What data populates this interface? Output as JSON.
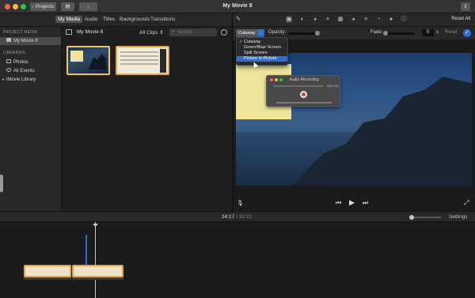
{
  "window": {
    "title": "My Movie 8"
  },
  "titlebar": {
    "projects_label": "Projects",
    "back_glyph": "‹"
  },
  "tabs": [
    {
      "label": "My Media",
      "active": true
    },
    {
      "label": "Audio",
      "active": false
    },
    {
      "label": "Titles",
      "active": false
    },
    {
      "label": "Backgrounds",
      "active": false
    },
    {
      "label": "Transitions",
      "active": false
    }
  ],
  "sidebar": {
    "project_header": "PROJECT MEDIA",
    "project_item": "My Movie 8",
    "libraries_header": "LIBRARIES",
    "library_items": [
      {
        "label": "Photos",
        "icon": "camera-icon"
      },
      {
        "label": "All Events",
        "icon": "star-icon"
      },
      {
        "label": "iMovie Library",
        "icon": "chevron-right-icon"
      }
    ]
  },
  "browser": {
    "title": "My Movie 8",
    "filter": "All Clips ⇕",
    "search_placeholder": "Search",
    "search_glyph": "⌕"
  },
  "adjustments": {
    "reset_all": "Reset All",
    "overlay_mode": "Cutaway",
    "opacity_label": "Opacity:",
    "fade_label": "Fade:",
    "fade_value": "0",
    "fade_unit": "s",
    "reset": "Reset",
    "apply_glyph": "✓"
  },
  "dropdown": {
    "options": [
      {
        "label": "Cutaway",
        "checked": true,
        "highlighted": false
      },
      {
        "label": "Green/Blue Screen",
        "checked": false,
        "highlighted": false
      },
      {
        "label": "Split Screen",
        "checked": false,
        "highlighted": false
      },
      {
        "label": "Picture in Picture",
        "checked": false,
        "highlighted": true
      }
    ],
    "check_glyph": "✓"
  },
  "recording": {
    "title": "Audio Recording",
    "size": "Zero KB"
  },
  "playback": {
    "prev_glyph": "⏮",
    "play_glyph": "▶",
    "next_glyph": "⏭",
    "mic_glyph": "🎙",
    "fullscreen_glyph": "⤢"
  },
  "timeline": {
    "current_time": "24:17",
    "separator": " / ",
    "total_time": "32:31",
    "settings_label": "Settings"
  },
  "colors": {
    "accent": "#2d6fd2",
    "clip_border": "#e4a44a"
  }
}
